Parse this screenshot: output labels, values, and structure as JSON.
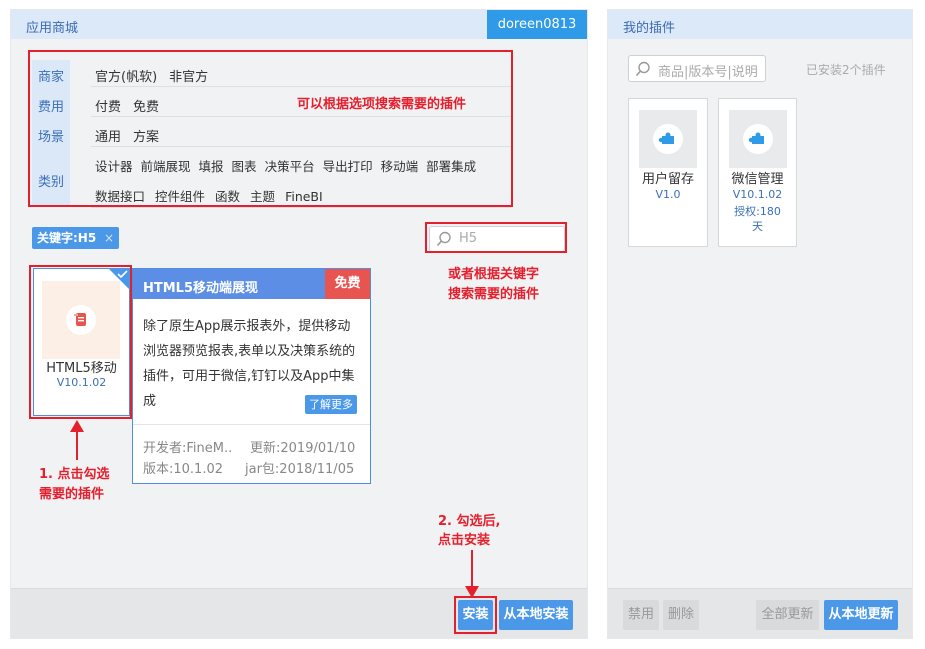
{
  "store": {
    "title": "应用商城",
    "user": "doreen0813",
    "filters": {
      "categories": [
        "商家",
        "费用",
        "场景",
        "类别"
      ],
      "merchant": [
        "官方(帆软)",
        "非官方"
      ],
      "fee": [
        "付费",
        "免费"
      ],
      "scene": [
        "通用",
        "方案"
      ],
      "type_row1": [
        "设计器",
        "前端展现",
        "填报",
        "图表",
        "决策平台",
        "导出打印",
        "移动端",
        "部署集成"
      ],
      "type_row2": [
        "数据接口",
        "控件组件",
        "函数",
        "主题",
        "FineBI"
      ]
    },
    "keyword_tag": "关键字:H5",
    "keyword_close": "×",
    "search_value": "H5",
    "plugin": {
      "name": "HTML5移动",
      "version": "V10.1.02",
      "checked": true
    },
    "detail": {
      "title": "HTML5移动端展现",
      "badge": "免费",
      "desc_lines": [
        "除了原生App展示报表外，提供移动",
        "浏览器预览报表,表单以及决策系统的",
        "插件，可用于微信,钉钉以及App中集",
        "成"
      ],
      "more": "了解更多",
      "developer": "开发者:FineM..",
      "updated": "更新:2019/01/10",
      "version": "版本:10.1.02",
      "jar": "jar包:2018/11/05"
    },
    "buttons": {
      "install": "安装",
      "install_local": "从本地安装"
    }
  },
  "annotations": {
    "filter_hint": "可以根据选项搜索需要的插件",
    "keyword_hint_1": "或者根据关键字",
    "keyword_hint_2": "搜索需要的插件",
    "step1_1": "1. 点击勾选",
    "step1_2": "需要的插件",
    "step2_1": "2. 勾选后,",
    "step2_2": "点击安装",
    "color": "#e5202e"
  },
  "my_plugins": {
    "title": "我的插件",
    "search_placeholder": "商品|版本号|说明",
    "installed_count": "已安装2个插件",
    "items": [
      {
        "name": "用户留存",
        "version": "V1.0"
      },
      {
        "name": "微信管理",
        "version": "V10.1.02",
        "license_1": "授权:180",
        "license_2": "天"
      }
    ],
    "buttons": {
      "disable": "禁用",
      "delete": "删除",
      "update_all": "全部更新",
      "update_local": "从本地更新"
    }
  }
}
